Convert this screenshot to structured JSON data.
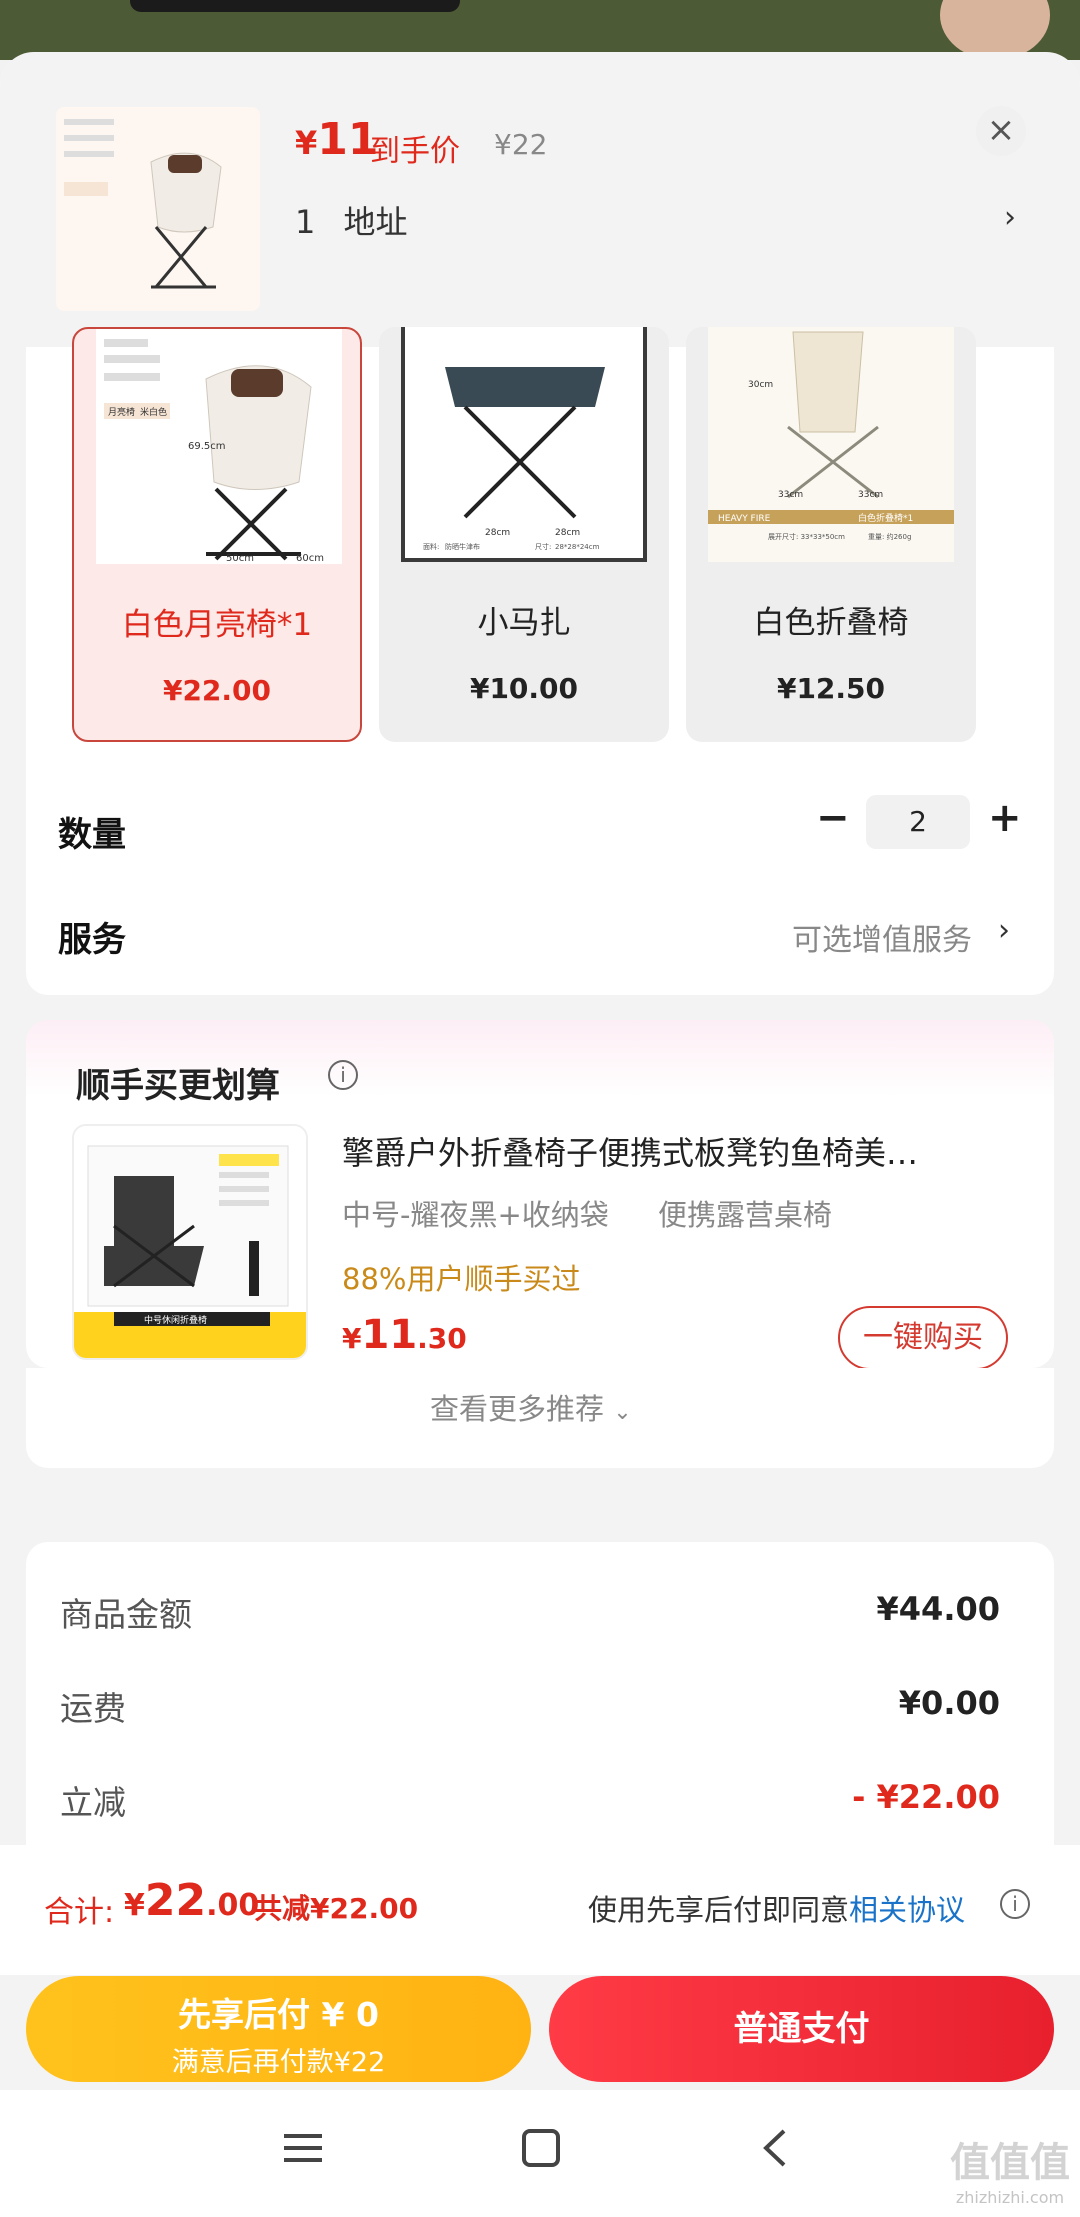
{
  "sheet": {
    "header": {
      "price_symbol": "¥",
      "price": "11",
      "price_label": "到手价",
      "original_price": "¥22",
      "address_count": "1",
      "address_label": "地址",
      "close_icon": "close-icon"
    },
    "options": [
      {
        "name": "白色月亮椅*1",
        "price": "¥22.00",
        "selected": true
      },
      {
        "name": "小马扎",
        "price": "¥10.00",
        "selected": false
      },
      {
        "name": "白色折叠椅",
        "price": "¥12.50",
        "selected": false
      }
    ],
    "quantity": {
      "label": "数量",
      "value": "2",
      "minus": "−",
      "plus": "+"
    },
    "service": {
      "label": "服务",
      "value": "可选增值服务"
    },
    "thumb_texts": {
      "moon_chair_dims": [
        "50cm",
        "60cm",
        "69.5cm"
      ],
      "moon_chair_tags": [
        "月亮椅",
        "米白色"
      ],
      "stool_dims": [
        "28cm",
        "28cm"
      ],
      "stool_specs": [
        "面料:",
        "防晒牛津布",
        "尺寸:",
        "28*28*24cm"
      ],
      "white_chair_banner": [
        "HEAVY FIRE",
        "白色折叠椅*1"
      ],
      "white_chair_specs": [
        "展开尺寸: 33*33*50cm",
        "重量: 约260g"
      ],
      "white_chair_dims": [
        "30cm",
        "33cm",
        "33cm"
      ]
    }
  },
  "recommend": {
    "title": "顺手买更划算",
    "info_icon": "info-icon",
    "product_title": "擎爵户外折叠椅子便携式板凳钓鱼椅美…",
    "product_spec": "中号-耀夜黑+收纳袋",
    "product_tag": "便携露营桌椅",
    "social_proof": "88%用户顺手买过",
    "price_symbol": "¥",
    "price_int": "11",
    "price_dec": ".30",
    "buy_button": "一键购买",
    "more_label": "查看更多推荐",
    "thumb_banner": "中号休闲折叠椅"
  },
  "summary": {
    "rows": [
      {
        "label": "商品金额",
        "value": "¥44.00"
      },
      {
        "label": "运费",
        "value": "¥0.00"
      },
      {
        "label": "立减",
        "value": "- ¥22.00"
      }
    ]
  },
  "footer": {
    "total_label": "合计:",
    "total_symbol": "¥",
    "total_int": "22",
    "total_dec": ".00",
    "total_saved": "共减¥22.00",
    "agreement_prefix": "使用先享后付即同意",
    "agreement_link": "相关协议",
    "btn_later_title": "先享后付 ¥ 0",
    "btn_later_sub": "满意后再付款¥22",
    "btn_pay": "普通支付"
  },
  "colors": {
    "accent": "#e0291d",
    "link": "#1a73c8",
    "gold": "#c98a1a",
    "yellow_btn": "#ffbb18",
    "red_btn": "#f02a38"
  },
  "watermark": {
    "top": "值值值",
    "bottom": "zhizhizhi.com"
  }
}
